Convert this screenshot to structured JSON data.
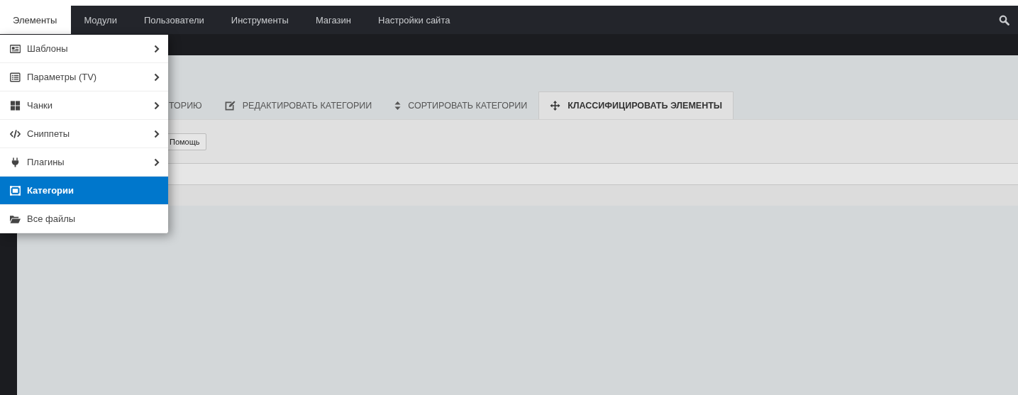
{
  "nav": {
    "items": [
      {
        "label": "Элементы",
        "selected": true
      },
      {
        "label": "Модули",
        "selected": false
      },
      {
        "label": "Пользователи",
        "selected": false
      },
      {
        "label": "Инструменты",
        "selected": false
      },
      {
        "label": "Магазин",
        "selected": false
      },
      {
        "label": "Настройки сайта",
        "selected": false
      }
    ]
  },
  "menu": {
    "items": [
      {
        "label": "Шаблоны",
        "kind": "template",
        "submenu": true,
        "selected": false
      },
      {
        "label": "Параметры (TV)",
        "kind": "list",
        "submenu": true,
        "selected": false
      },
      {
        "label": "Чанки",
        "kind": "grid",
        "submenu": true,
        "selected": false
      },
      {
        "label": "Сниппеты",
        "kind": "code",
        "submenu": true,
        "selected": false
      },
      {
        "label": "Плагины",
        "kind": "plug",
        "submenu": true,
        "selected": false
      },
      {
        "label": "Категории",
        "kind": "category",
        "submenu": false,
        "selected": true
      },
      {
        "label": "Все файлы",
        "kind": "folder",
        "submenu": false,
        "selected": false
      }
    ]
  },
  "tabs": [
    {
      "label": "ТОРИЮ",
      "kind": "plain",
      "selected": false
    },
    {
      "label": "РЕДАКТИРОВАТЬ КАТЕГОРИИ",
      "kind": "edit",
      "selected": false
    },
    {
      "label": "СОРТИРОВАТЬ КАТЕГОРИИ",
      "kind": "sort",
      "selected": false
    },
    {
      "label": "КЛАССИФИЦИРОВАТЬ ЭЛЕМЕНТЫ",
      "kind": "move",
      "selected": true
    }
  ],
  "toolbar": {
    "help_button": "Помощь"
  }
}
